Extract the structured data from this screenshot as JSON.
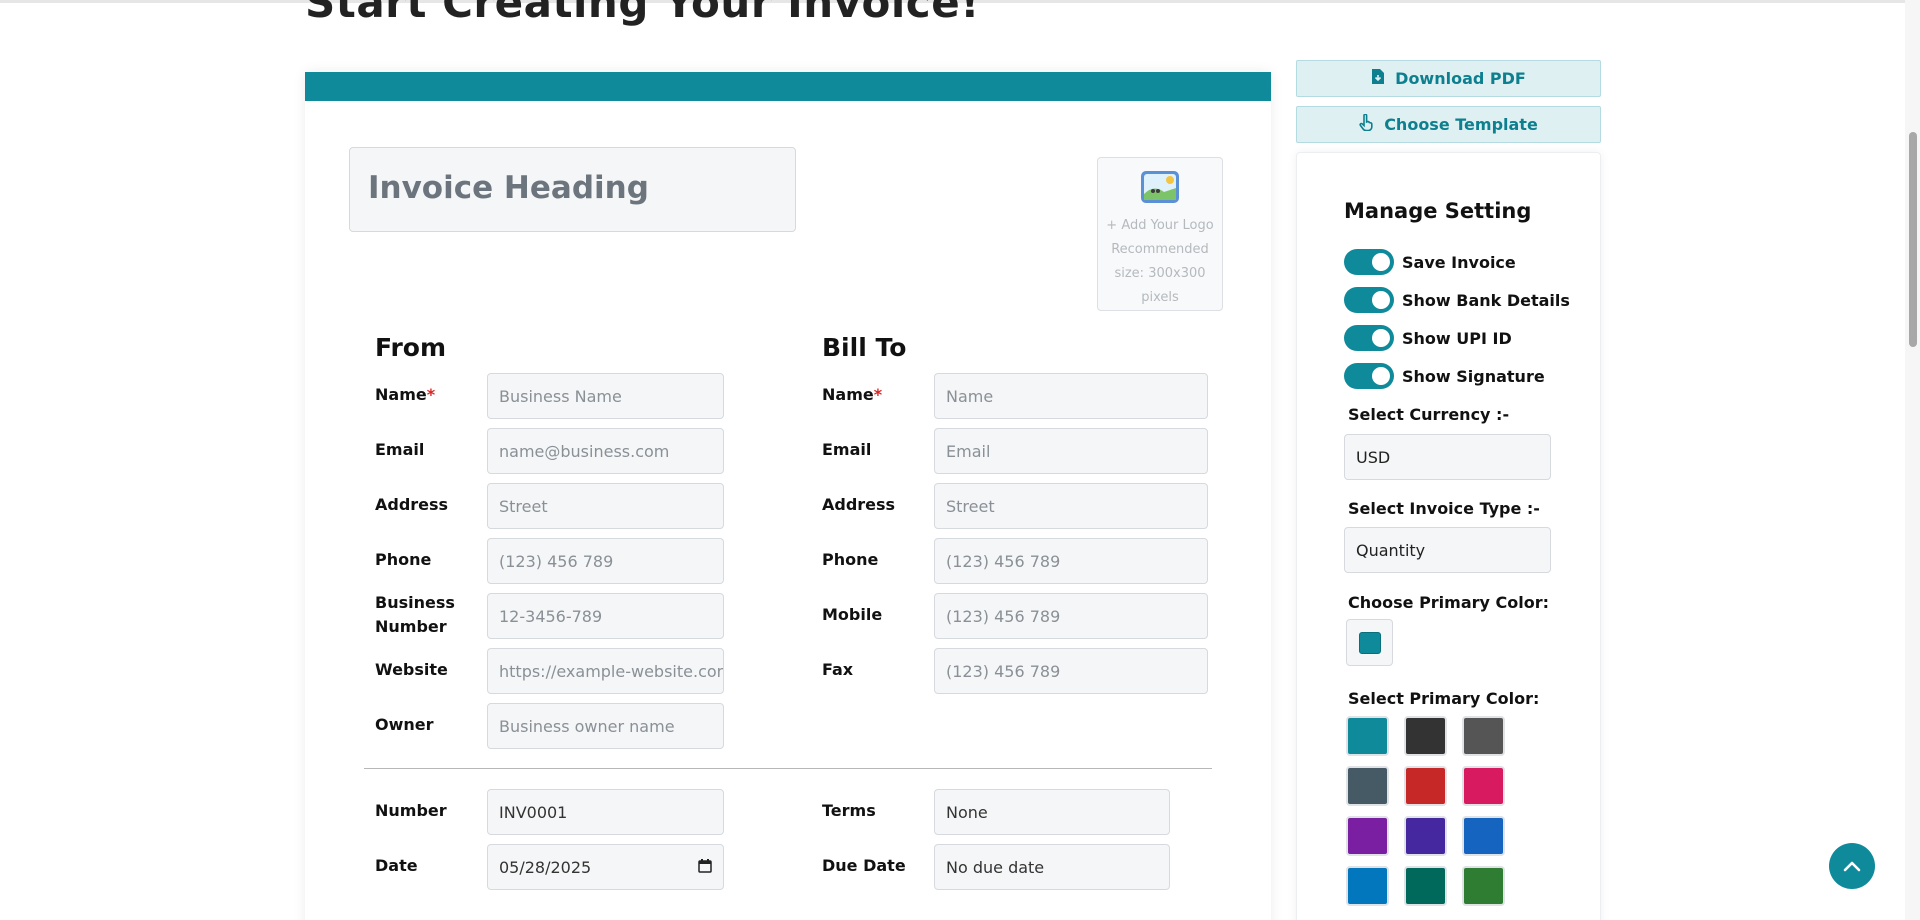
{
  "page": {
    "heading": "Start Creating Your Invoice!"
  },
  "invoice": {
    "heading_placeholder": "Invoice Heading",
    "logo": {
      "line1": "+ Add Your Logo",
      "line2": "Recommended",
      "line3": "size: 300x300",
      "line4": "pixels"
    },
    "from": {
      "title": "From",
      "fields": [
        {
          "label": "Name",
          "required": "*",
          "placeholder": "Business Name"
        },
        {
          "label": "Email",
          "placeholder": "name@business.com"
        },
        {
          "label": "Address",
          "placeholder": "Street"
        },
        {
          "label": "Phone",
          "placeholder": "(123) 456 789"
        },
        {
          "label": "Business Number",
          "placeholder": "12-3456-789"
        },
        {
          "label": "Website",
          "placeholder": "https://example-website.com"
        },
        {
          "label": "Owner",
          "placeholder": "Business owner name"
        }
      ]
    },
    "bill_to": {
      "title": "Bill To",
      "fields": [
        {
          "label": "Name",
          "required": "*",
          "placeholder": "Name"
        },
        {
          "label": "Email",
          "placeholder": "Email"
        },
        {
          "label": "Address",
          "placeholder": "Street"
        },
        {
          "label": "Phone",
          "placeholder": "(123) 456 789"
        },
        {
          "label": "Mobile",
          "placeholder": "(123) 456 789"
        },
        {
          "label": "Fax",
          "placeholder": "(123) 456 789"
        }
      ]
    },
    "meta": {
      "number_label": "Number",
      "number_value": "INV0001",
      "date_label": "Date",
      "date_value": "05/28/2025",
      "terms_label": "Terms",
      "terms_value": "None",
      "due_label": "Due Date",
      "due_value": "No due date"
    }
  },
  "sidebar": {
    "download_label": "Download PDF",
    "template_label": "Choose Template",
    "settings_title": "Manage Setting",
    "toggles": [
      {
        "label": "Save Invoice",
        "on": true
      },
      {
        "label": "Show Bank Details",
        "on": true
      },
      {
        "label": "Show UPI ID",
        "on": true
      },
      {
        "label": "Show Signature",
        "on": true
      }
    ],
    "currency_label": "Select Currency :-",
    "currency_value": "USD",
    "invoice_type_label": "Select Invoice Type :-",
    "invoice_type_value": "Quantity",
    "choose_color_label": "Choose Primary Color:",
    "primary_color": "#0e8a9b",
    "select_color_label": "Select Primary Color:",
    "swatches": [
      "#0e8a9b",
      "#333333",
      "#555555",
      "#455a64",
      "#c62828",
      "#d81b60",
      "#7b1fa2",
      "#4527a0",
      "#1565c0",
      "#0277bd",
      "#00695c",
      "#2e7d32"
    ]
  },
  "icons": {
    "download": "file-download-icon",
    "template": "hand-pointer-icon",
    "logo": "image-icon",
    "calendar": "calendar-icon",
    "fab": "chevron-up-icon"
  }
}
